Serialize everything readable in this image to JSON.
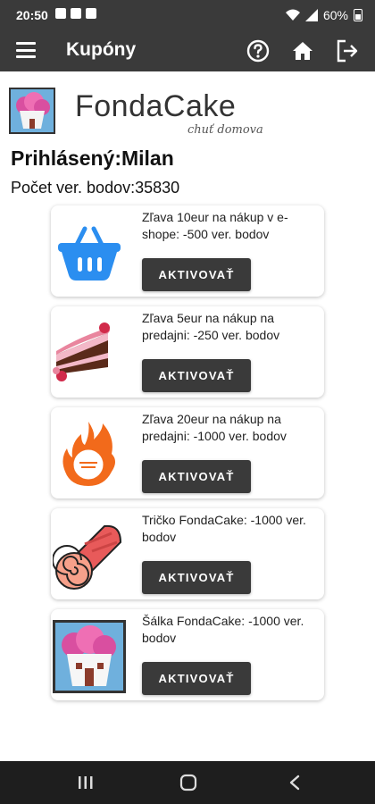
{
  "status_bar": {
    "time": "20:50",
    "battery": "60%"
  },
  "app_bar": {
    "title": "Kupóny"
  },
  "brand": {
    "name": "FondaCake",
    "tagline": "chuť domova"
  },
  "user": {
    "logged_in": "Prihlásený:Milan",
    "points": "Počet ver. bodov:35830"
  },
  "coupons": [
    {
      "text": "Zľava 10eur na nákup v e-shope: -500 ver. bodov",
      "button": "AKTIVOVAŤ",
      "icon": "basket-icon"
    },
    {
      "text": "Zľava 5eur na nákup na predajni: -250 ver. bodov",
      "button": "AKTIVOVAŤ",
      "icon": "cake-slice-icon"
    },
    {
      "text": "Zľava 20eur na nákup na predajni: -1000 ver. bodov",
      "button": "AKTIVOVAŤ",
      "icon": "flame-badge-icon"
    },
    {
      "text": "Tričko FondaCake: -1000 ver. bodov",
      "button": "AKTIVOVAŤ",
      "icon": "roll-cake-icon"
    },
    {
      "text": "Šálka FondaCake: -1000 ver. bodov",
      "button": "AKTIVOVAŤ",
      "icon": "cupcake-house-icon"
    }
  ],
  "colors": {
    "bar": "#3a3a3a",
    "button": "#3a3a3a",
    "nav": "#1e1e1e",
    "basket": "#2b8ef0"
  }
}
